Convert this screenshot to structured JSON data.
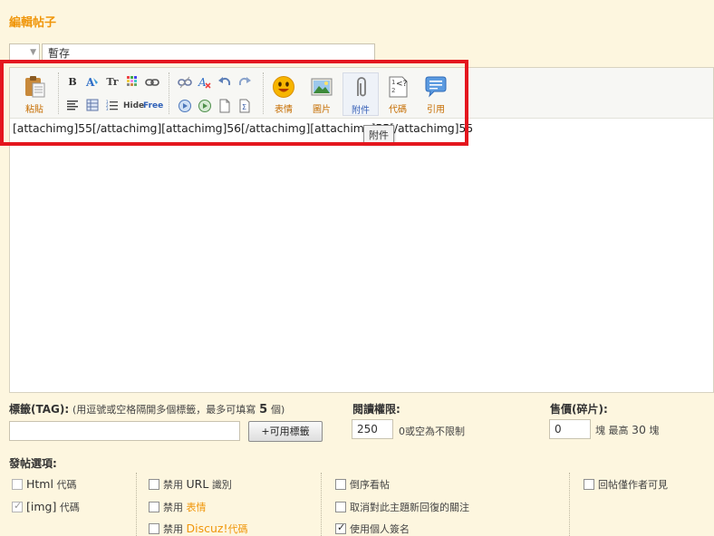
{
  "header": {
    "title": "編輯帖子"
  },
  "subject": {
    "value": "暫存"
  },
  "toolbar": {
    "paste": "粘貼",
    "smilies": "表情",
    "image": "圖片",
    "attach": "附件",
    "code": "代碼",
    "quote": "引用",
    "bold": "B",
    "font_size": "Tr",
    "hide": "Hide",
    "free": "Free"
  },
  "editor": {
    "content": "[attachimg]55[/attachimg][attachimg]56[/attachimg][attachimg]55[/attachimg]55",
    "tooltip": "附件"
  },
  "tags": {
    "label": "標籤(TAG):",
    "hint": "(用逗號或空格隔開多個標籤，最多可填寫",
    "max": "5",
    "hint_end": "個)",
    "button": "+可用標籤",
    "value": ""
  },
  "read_perm": {
    "label": "閱讀權限:",
    "value": "250",
    "hint": "0或空為不限制"
  },
  "price": {
    "label": "售價(碎片):",
    "value": "0",
    "unit": "塊",
    "max_text": "最高",
    "max": "30",
    "max_unit": "塊"
  },
  "options": {
    "title": "發帖選項:",
    "html": {
      "en": "Html",
      "zh": "代碼"
    },
    "img": {
      "en": "[img]",
      "zh": "代碼"
    },
    "disable_url": {
      "pre": "禁用",
      "en": "URL",
      "post": "識別"
    },
    "disable_smilies": {
      "pre": "禁用",
      "highlight": "表情"
    },
    "disable_discuz": {
      "pre": "禁用",
      "highlight": "Discuz!",
      "post": "代碼"
    },
    "reverse": "倒序看帖",
    "cancel_notify": "取消對此主題新回復的關注",
    "use_signature": "使用個人簽名",
    "author_only": "回帖僅作者可見"
  }
}
